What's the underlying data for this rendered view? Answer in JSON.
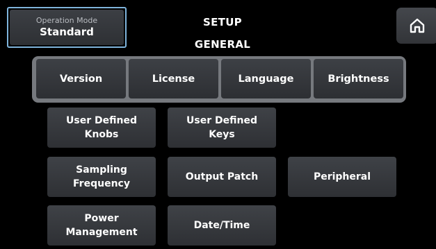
{
  "operation_mode": {
    "caption": "Operation Mode",
    "value": "Standard"
  },
  "header": {
    "title": "SETUP",
    "subtitle": "GENERAL"
  },
  "home": {
    "icon": "home-icon"
  },
  "tabs": [
    {
      "label": "Version"
    },
    {
      "label": "License"
    },
    {
      "label": "Language"
    },
    {
      "label": "Brightness"
    }
  ],
  "buttons": {
    "user_defined_knobs": "User Defined\nKnobs",
    "user_defined_keys": "User Defined\nKeys",
    "sampling_frequency": "Sampling\nFrequency",
    "output_patch": "Output Patch",
    "peripheral": "Peripheral",
    "power_management": "Power\nManagement",
    "date_time": "Date/Time"
  },
  "colors": {
    "background": "#000000",
    "button": "#35383c",
    "tabbar_frame": "#76797e",
    "mode_outline": "#7fb4dc"
  }
}
